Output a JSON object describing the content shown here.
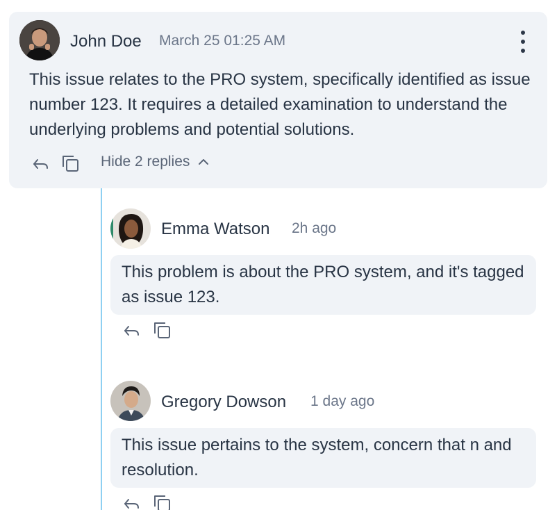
{
  "main_comment": {
    "author": "John Doe",
    "timestamp": "March 25 01:25 AM",
    "text": "This issue relates to the PRO system, specifically identified as issue number 123. It requires a detailed examination to understand the underlying problems and potential solutions.",
    "toggle_label": "Hide 2 replies",
    "icons": {
      "reply": "reply-icon",
      "copy": "copy-icon",
      "more": "more-vertical-icon",
      "toggle": "chevron-up-icon"
    }
  },
  "replies": [
    {
      "author": "Emma Watson",
      "timestamp": "2h ago",
      "text": "This problem is about the PRO system, and it's tagged as issue 123."
    },
    {
      "author": "Gregory Dowson",
      "timestamp": "1 day ago",
      "text": "This issue pertains to the system, concern that n and resolution."
    }
  ],
  "colors": {
    "card_bg": "#f0f3f7",
    "text": "#283444",
    "muted": "#6b7689",
    "thread_line": "#8ed0f2"
  }
}
